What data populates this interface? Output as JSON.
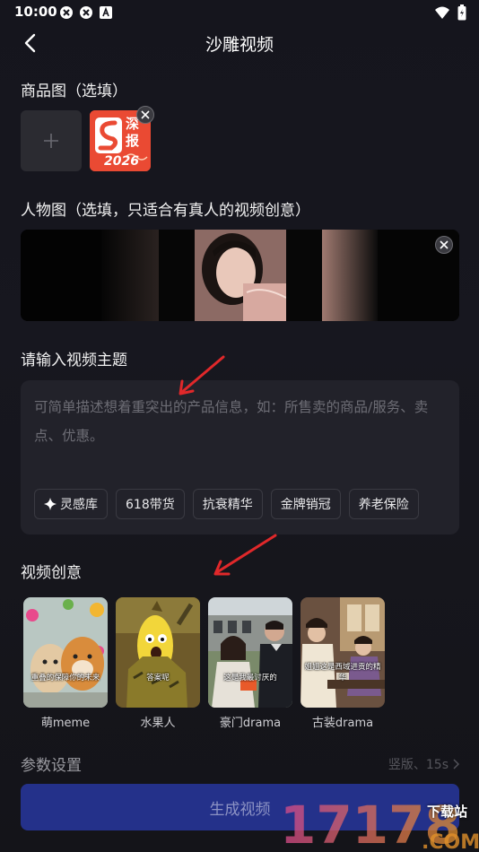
{
  "status": {
    "time": "10:00"
  },
  "nav": {
    "title": "沙雕视频"
  },
  "product": {
    "label": "商品图（选填）",
    "thumb_text": "深报"
  },
  "person": {
    "label": "人物图（选填，只适合有真人的视频创意）"
  },
  "topic": {
    "label": "请输入视频主题",
    "placeholder": "可简单描述想着重突出的产品信息，如：所售卖的商品/服务、卖点、优惠。",
    "chips": [
      "灵感库",
      "618带货",
      "抗衰精华",
      "金牌销冠",
      "养老保险"
    ]
  },
  "ideas": {
    "label": "视频创意",
    "items": [
      {
        "name": "萌meme",
        "caption": "重叠的保障你的未来"
      },
      {
        "name": "水果人",
        "caption": "答案呢"
      },
      {
        "name": "豪门drama",
        "caption": "这是我最讨厌的"
      },
      {
        "name": "古装drama",
        "caption": "姐姐这是西域进贡的精华"
      }
    ]
  },
  "params": {
    "label": "参数设置",
    "value": "竖版、15s"
  },
  "generate": {
    "label": "生成视频"
  },
  "watermark": {
    "main": "17178",
    "sub": "下载站",
    "domain": ".COM"
  },
  "colors": {
    "background": "#15151d",
    "accent": "#24318a",
    "arrow": "#e0282a"
  }
}
